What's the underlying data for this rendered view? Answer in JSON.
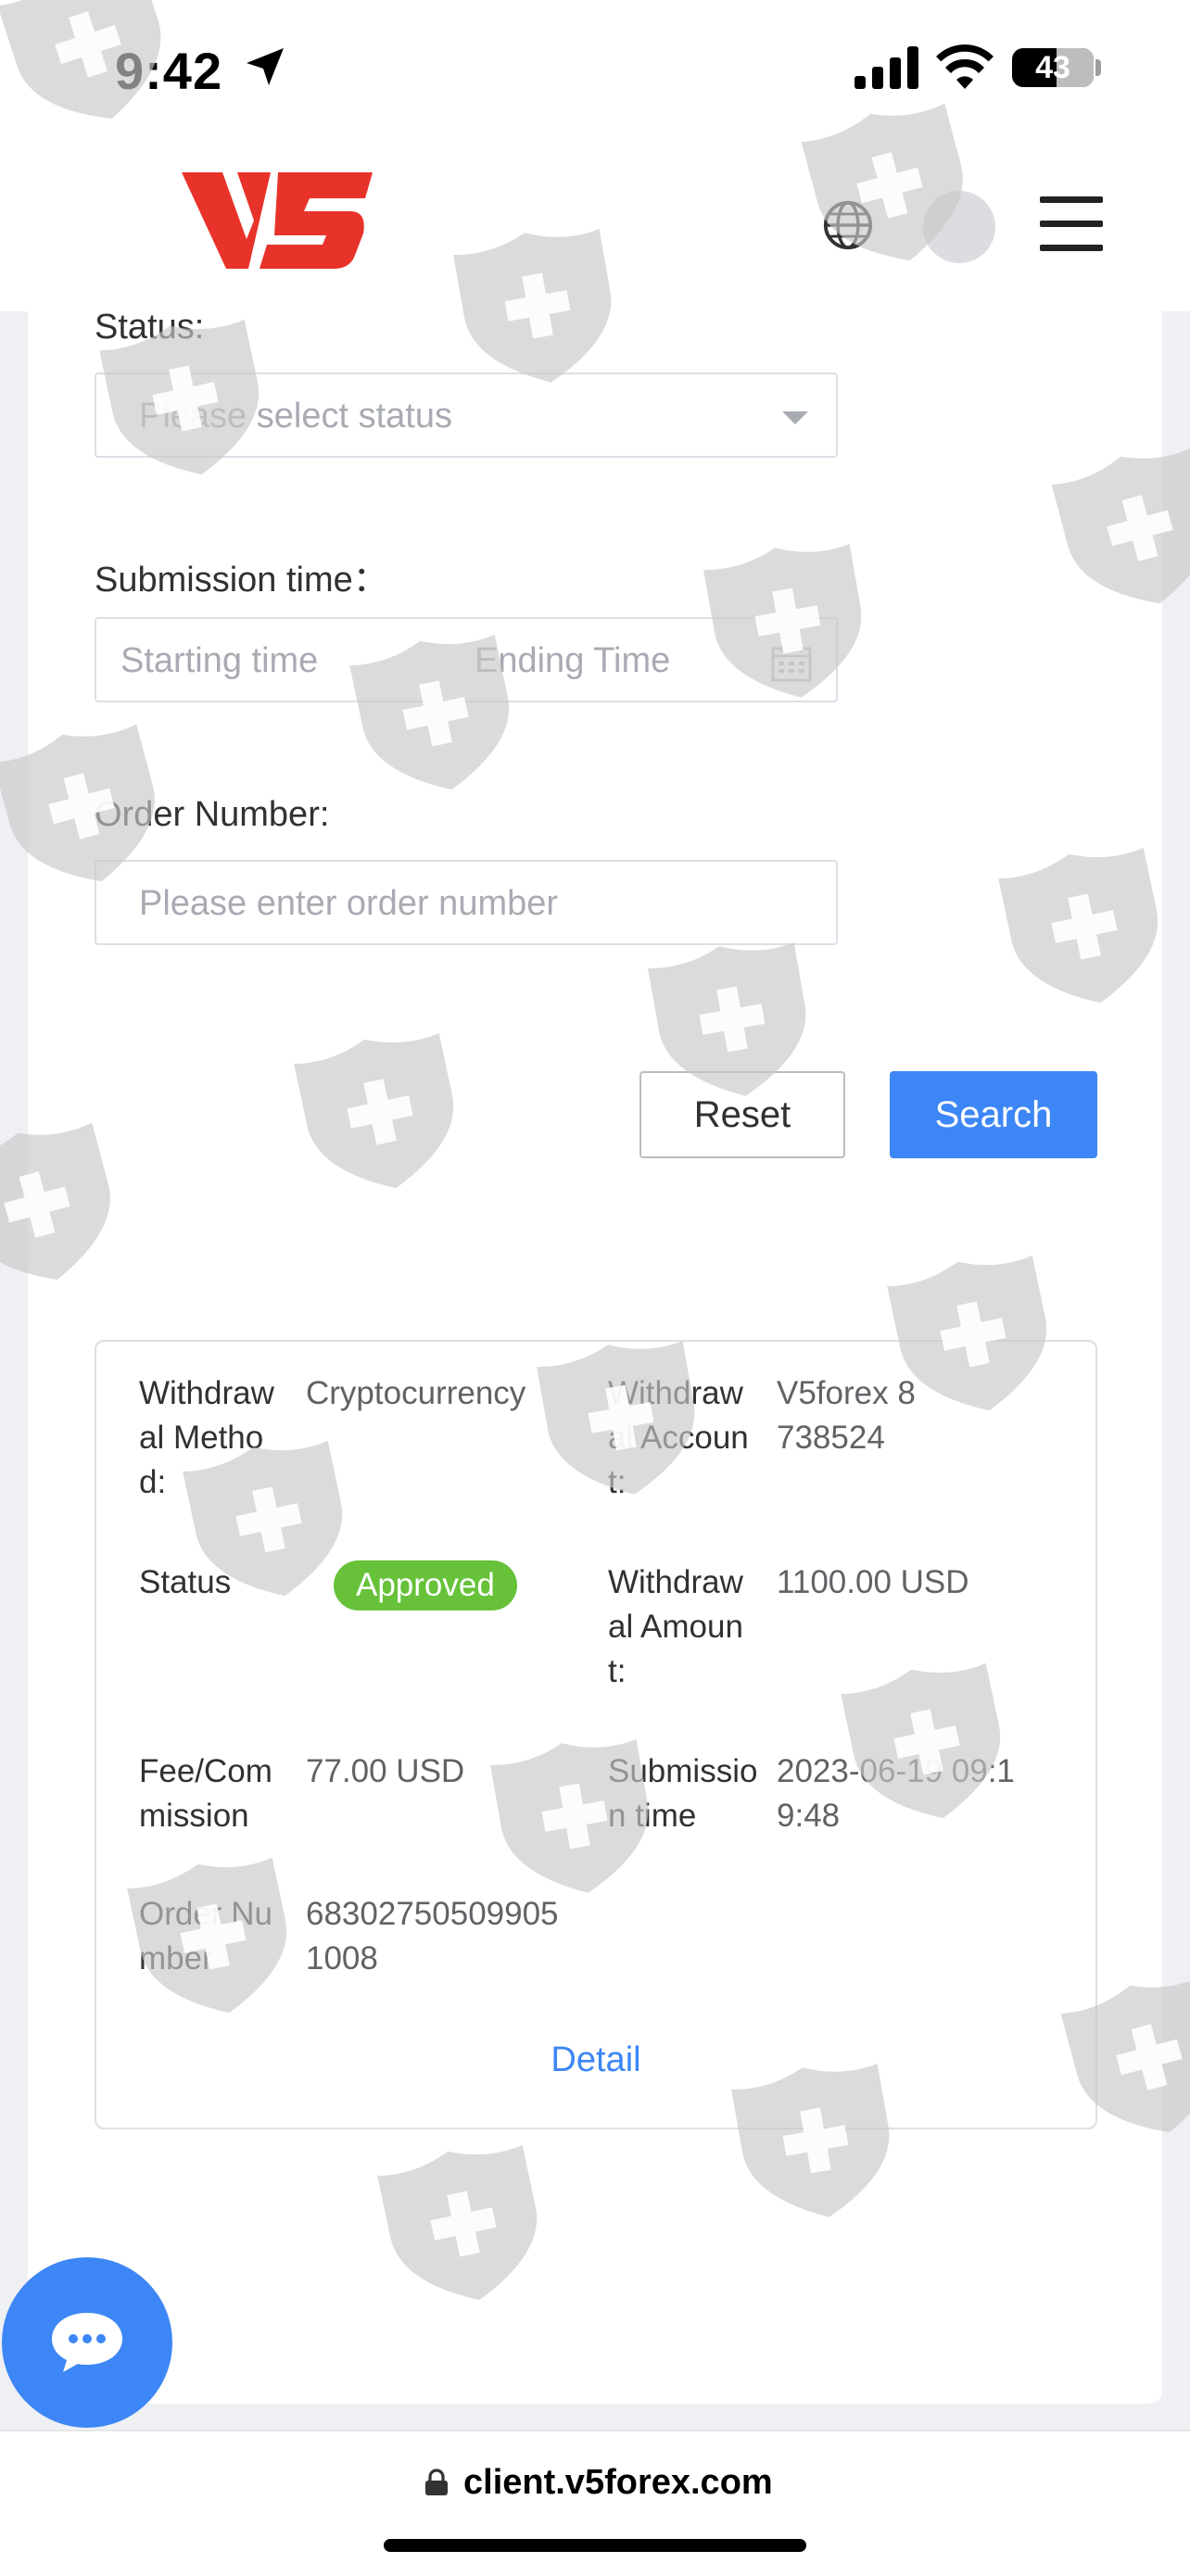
{
  "status_bar": {
    "time": "9:42",
    "battery": "43"
  },
  "header": {
    "logo_text": "V5",
    "icons": [
      "globe-icon",
      "avatar",
      "menu-icon"
    ]
  },
  "filters": {
    "status_label": "Status:",
    "status_placeholder": "Please select status",
    "submission_label": "Submission time：",
    "start_placeholder": "Starting time",
    "end_placeholder": "Ending Time",
    "order_label": "Order Number:",
    "order_placeholder": "Please enter order number",
    "reset_label": "Reset",
    "search_label": "Search"
  },
  "record": {
    "method_key": "Withdrawal Method:",
    "method_value": "Cryptocurrency",
    "account_key": "Withdrawal Account:",
    "account_value": "V5forex 8738524",
    "status_key": "Status",
    "status_value": "Approved",
    "amount_key": "Withdrawal Amount:",
    "amount_value": "1100.00 USD",
    "fee_key": "Fee/Commission",
    "fee_value": "77.00 USD",
    "time_key": "Submission time",
    "time_value": "2023-06-19 09:19:48",
    "order_key": "Order Number",
    "order_value": "683027505099051008",
    "detail_label": "Detail"
  },
  "colors": {
    "primary": "#3d86f5",
    "success": "#67c23a",
    "brand_red": "#e8332a"
  },
  "url_bar": {
    "domain": "client.v5forex.com"
  }
}
